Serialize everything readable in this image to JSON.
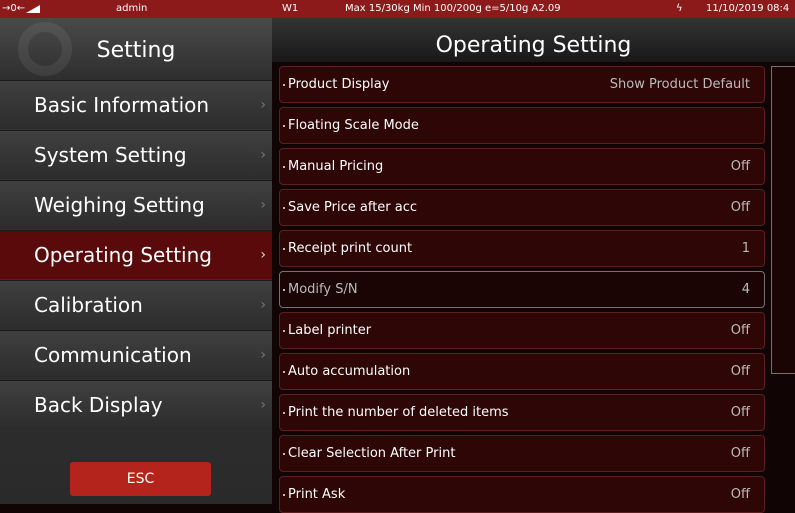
{
  "status_bar": {
    "indicator": "→0←",
    "user": "admin",
    "channel": "W1",
    "capacity": "Max 15/30kg  Min 100/200g e=5/10g A2.09",
    "power_icon": "lightning-icon",
    "datetime": "11/10/2019 08:4"
  },
  "sidebar": {
    "title": "Setting",
    "items": [
      {
        "label": "Basic Information",
        "chevron": "›"
      },
      {
        "label": "System Setting",
        "chevron": "›"
      },
      {
        "label": "Weighing Setting",
        "chevron": "›"
      },
      {
        "label": "Operating Setting",
        "chevron": "›",
        "active": true
      },
      {
        "label": "Calibration",
        "chevron": "›"
      },
      {
        "label": "Communication",
        "chevron": "›"
      },
      {
        "label": "Back Display",
        "chevron": "›"
      }
    ],
    "esc_label": "ESC"
  },
  "main": {
    "title": "Operating Setting",
    "rows": [
      {
        "label": "Product Display",
        "value": "Show Product Default"
      },
      {
        "label": "Floating Scale Mode",
        "value": ""
      },
      {
        "label": "Manual Pricing",
        "value": "Off"
      },
      {
        "label": "Save Price after acc",
        "value": "Off"
      },
      {
        "label": "Receipt print count",
        "value": "1"
      },
      {
        "label": "Modify S/N",
        "value": "4"
      },
      {
        "label": "Label printer",
        "value": "Off"
      },
      {
        "label": "Auto accumulation",
        "value": "Off"
      },
      {
        "label": "Print the number of deleted items",
        "value": "Off"
      },
      {
        "label": "Clear Selection After Print",
        "value": "Off"
      },
      {
        "label": "Print Ask",
        "value": "Off"
      }
    ]
  },
  "colors": {
    "status_bar": "#8c1a1a",
    "active_item": "#5a0a0a",
    "esc_button": "#b5241c",
    "row_bg": "#2e0606"
  }
}
